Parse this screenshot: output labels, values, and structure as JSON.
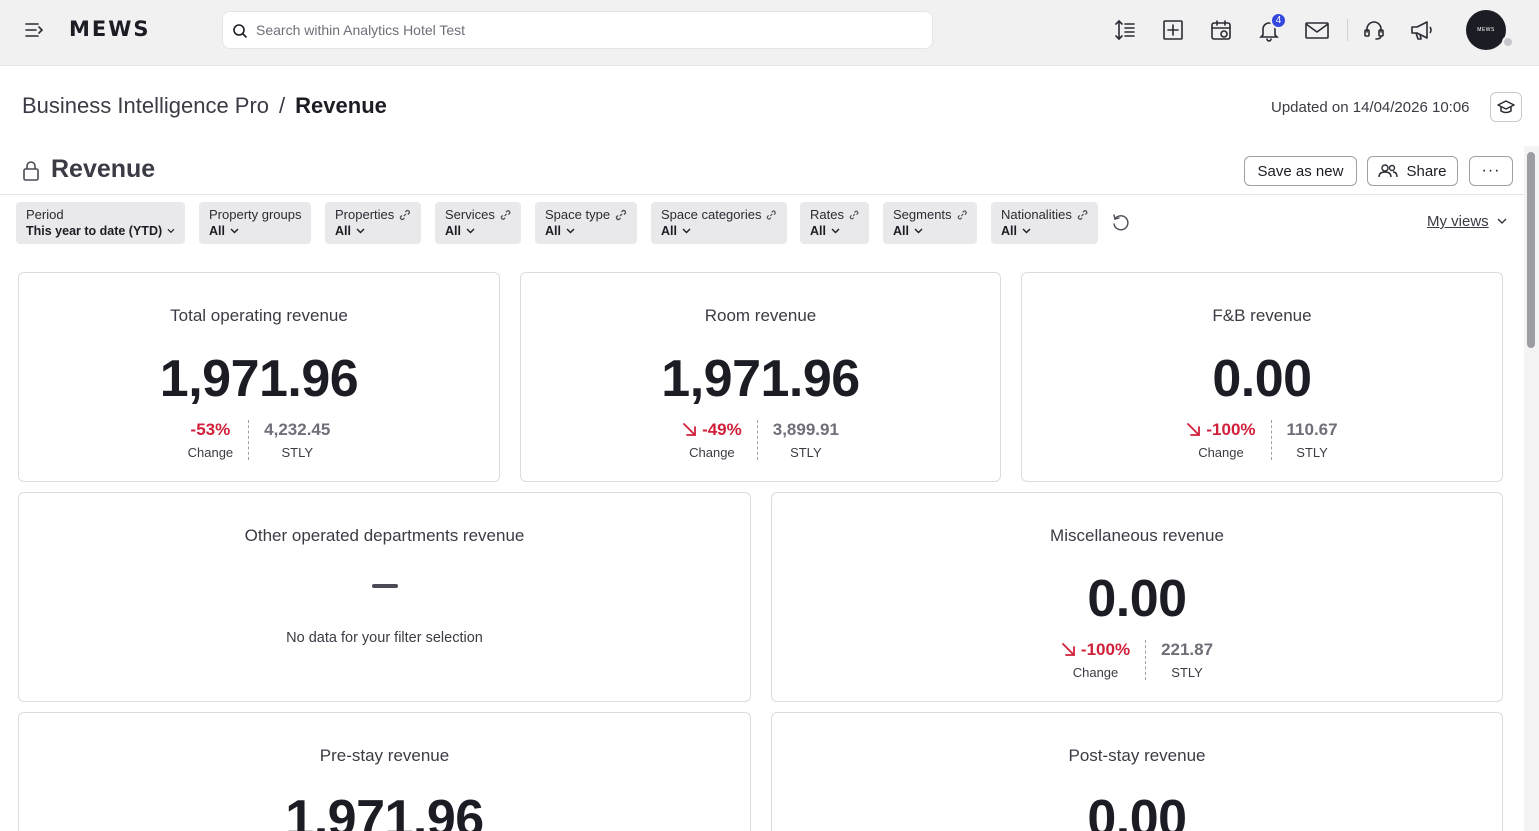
{
  "topbar": {
    "logo": "MEWS",
    "search_placeholder": "Search within Analytics Hotel Test",
    "notification_count": "4",
    "avatar_text": "MEWS"
  },
  "header": {
    "breadcrumb_parent": "Business Intelligence Pro",
    "breadcrumb_separator": "/",
    "breadcrumb_current": "Revenue",
    "updated": "Updated on 14/04/2026 10:06"
  },
  "report": {
    "title": "Revenue",
    "save_as_new": "Save as new",
    "share": "Share",
    "more": "···"
  },
  "filters": [
    {
      "label": "Period",
      "value": "This year to date (YTD)"
    },
    {
      "label": "Property groups",
      "value": "All"
    },
    {
      "label": "Properties",
      "value": "All"
    },
    {
      "label": "Services",
      "value": "All"
    },
    {
      "label": "Space type",
      "value": "All"
    },
    {
      "label": "Space categories",
      "value": "All"
    },
    {
      "label": "Rates",
      "value": "All"
    },
    {
      "label": "Segments",
      "value": "All"
    },
    {
      "label": "Nationalities",
      "value": "All"
    }
  ],
  "my_views": "My views",
  "cards": {
    "total_operating": {
      "title": "Total operating revenue",
      "value": "1,971.96",
      "change": "-53%",
      "change_label": "Change",
      "stly": "4,232.45",
      "stly_label": "STLY"
    },
    "room": {
      "title": "Room revenue",
      "value": "1,971.96",
      "change": "-49%",
      "change_label": "Change",
      "stly": "3,899.91",
      "stly_label": "STLY"
    },
    "fnb": {
      "title": "F&B revenue",
      "value": "0.00",
      "change": "-100%",
      "change_label": "Change",
      "stly": "110.67",
      "stly_label": "STLY"
    },
    "other_departments": {
      "title": "Other operated departments revenue",
      "no_data": "No data for your filter selection"
    },
    "miscellaneous": {
      "title": "Miscellaneous revenue",
      "value": "0.00",
      "change": "-100%",
      "change_label": "Change",
      "stly": "221.87",
      "stly_label": "STLY"
    },
    "pre_stay": {
      "title": "Pre-stay revenue",
      "value": "1,971.96"
    },
    "post_stay": {
      "title": "Post-stay revenue",
      "value": "0.00"
    }
  },
  "colors": {
    "negative": "#d0203a",
    "accent_badge": "#3448e0",
    "text_primary": "#1c1d24"
  }
}
